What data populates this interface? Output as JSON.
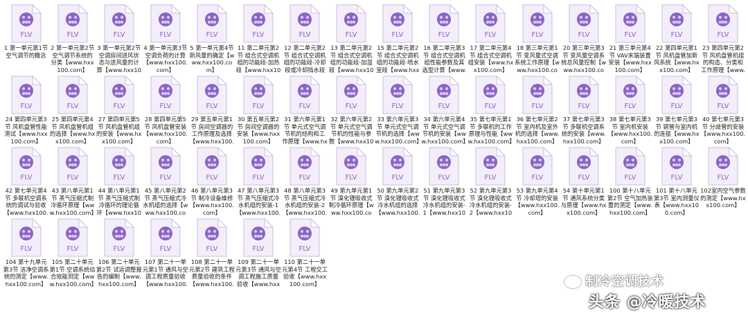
{
  "icon_type": "FLV",
  "colors": {
    "icon_purple": "#8a63c4",
    "icon_light": "#d8c9ef",
    "page_bg": "#f3eef9"
  },
  "files": [
    "1 第一单元第1节 空气调节的概念",
    "2 第一单元第2节 空气调节系统的分类【www.hxx100.com】",
    "3 第一单元第2节 空调房间送风状态与送风量的计算【www.hxx100.com】",
    "4 第一单元第3节 空调负荷的计算【www.hxx100.com】",
    "5 第一单元第4节 新风量的确定【www.hxx100.com】",
    "11 第二单元第2节 组合式空调机组的功能段-加热段【www.hxx100.com】",
    "12 第二单元第2节 组合式空调机组的功能段-冷却段或冷却挡水段【www.hxx100.com】",
    "13 第二单元第2节 组合式空调机组的功能段-加湿段【www.hxx100.com】",
    "15 第二单元第2节 组合式空调机组的功能段-喷水室段【www.hxx100.com】",
    "16 第二单元第3节 组合式空调机组性能参数及其选型计算【www.hxx100.com】",
    "17 第二单元第4节 组合式空调机组安装【www.hxx100.com】",
    "18 第三单元第1节 变风量式空调系统工作原理【www.hxx100.com】",
    "20 第三单元第3节 变风量空调系统总风量控制【www.hxx100.com】",
    "21 第三单元第4节 VAV末端装置安装【www.hxx100.com】",
    "22 第四单元第1节 风机盘管加新风系统【www.hxx100.com】",
    "23 第四单元第2节 风机盘管机组的构造、分类和工作原理【www.hxx100.com】",
    "24 第四单元第3节 风机盘管性能测试【www.hxx100.com】",
    "25 第四单元第4节 风机盘管机组的选择【www.hxx100.com】",
    "27 第四单元第5节 风机盘管机组的安装【www.hxx100.com】",
    "28 第四单元第5节 风机盘管安装【www.hxx100.com】",
    "29 第五单元第1节 房间空调器的工作原理及选择【www.hxx100.com】",
    "30 第五单元第2节 房间空调器的安装【www.hxx100.com】",
    "31 第六单元第1节 单元式空气调节机的结构和工作原理【www.hxx100.com】",
    "32 第六单元第2节 单元式空气调节机的性能与参数【www.hxx100.com】",
    "33 第六单元第3节 单元式空气调节机的选择【www.hxx100.com】",
    "34 第六单元第4节 单元式空气调节机的安装【www.hxx100.com】",
    "35 第七单元第1节 多联机的工作原理与性能【www.hxx100.com】",
    "36 第七单元第2节 室内机及室外机的选择【www.hxx100.com】",
    "37 第七单元第3节 多联机空调系统的安装【www.hxx100.com】",
    "38 第七单元第3节 室内机安装【www.hxx100.com】",
    "39 第七单元第3节 铜管与室内机的连接【www.hxx100.com】",
    "40 第七单元第3节 分歧管的安装【www.hxx100.com】",
    "42 第七单元第4节 多联机空调系统的调试与验收【www.hxx100.com】",
    "43 第八单元第1节 蒸气压缩式制冷循环原理【www.hxx100.com】",
    "44 第八单元第1节 蒸气压缩式制冷循环的理论循环【www.hxx100.com】",
    "45 第八单元第2节 蒸气压缩式冷水机组的选择【www.hxx100.com】",
    "46 第八单元第3节 制冷设备维修【www.hxx100.com】",
    "47 第八单元第3节 蒸气压缩式冷水机组的安装-1【www.hxx100.com】",
    "48 第八单元第3节 蒸气压缩式冷水机组的安装-2【www.hxx100.com】",
    "49 第九单元第1节 溴化锂吸收式制冷循环原理【www.hxx100.com】",
    "50 第九单元第2节 溴化锂吸收式冷水机组的选择【www.hxx100.com】",
    "51 第九单元第3节 溴化锂吸收式冷水机组的安装-1【www.hxx100.com】",
    "52 第九单元第3节 溴化锂吸收式冷水机组的安装-2【www.hxx100.com】",
    "53 第九单元第4节 冷却塔的安装【www.hxx100.com】",
    "54 第十单元第1节 通风系统分类与原理【www.hxx100.com】",
    "100 第十八单元第2节 空气加热装置的测定【www.hxx100.com】",
    "101 第十八单元第3节 室内测量仪表【www.hxx100.com】",
    "102室内空气参数的测定【www.hxx100.com】",
    "104 第十九单元第3节 洁净空调系统的测定【www.hxx100.com】",
    "105 第二十单元第1节 空调系统综合效能测定【www.hxx100.com】",
    "106 第二十单元第2节 试运调整报告的编制【www.hxx100.com】",
    "107 第二十一单元第1节 通风与空调工程质量验收【www.hxx100.com】",
    "108 第二十一单元第2节 建筑工程质量验收的条件【www.hxx100.com】",
    "109 第二十一单元第3节 通风与空调工程施工质量验收【www.hxx100.com】",
    "110 第二十一单元第4节 工程交工验收【www.hxx100.com】"
  ],
  "watermark": {
    "wechat_account": "制冷空调技术",
    "toutiao_account": "头条 @冷暖技术"
  }
}
